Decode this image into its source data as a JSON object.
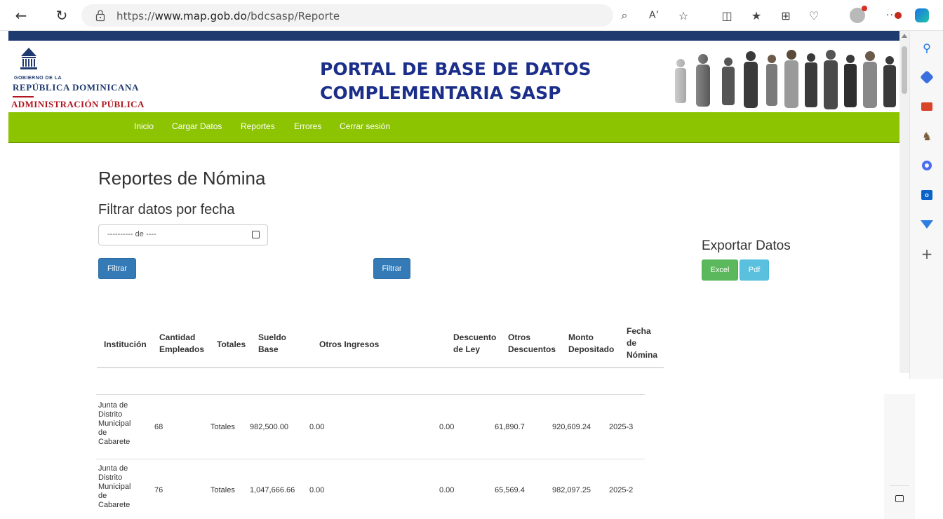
{
  "browser": {
    "url_prefix": "https://",
    "url_domain": "www.map.gob.do",
    "url_path": "/bdcsasp/Reporte"
  },
  "logo": {
    "line1": "GOBIERNO DE LA",
    "line2": "REPÚBLICA DOMINICANA",
    "line3": "ADMINISTRACIÓN PÚBLICA"
  },
  "header": {
    "title_line1": "PORTAL DE BASE DE DATOS",
    "title_line2": "COMPLEMENTARIA SASP"
  },
  "nav": {
    "items": [
      "Inicio",
      "Cargar Datos",
      "Reportes",
      "Errores",
      "Cerrar sesión"
    ]
  },
  "main": {
    "page_title": "Reportes de Nómina",
    "filter_title": "Filtrar datos por fecha",
    "date_placeholder": "---------- de ----",
    "filter_button": "Filtrar",
    "filter_button_2": "Filtrar",
    "export_title": "Exportar Datos",
    "excel_button": "Excel",
    "pdf_button": "Pdf"
  },
  "table": {
    "headers": {
      "institucion": "Institución",
      "cantidad_1": "Cantidad",
      "cantidad_2": "Empleados",
      "totales": "Totales",
      "sueldo_1": "Sueldo",
      "sueldo_2": "Base",
      "otros_ingresos": "Otros Ingresos",
      "descuento_1": "Descuento",
      "descuento_2": "de Ley",
      "otros_desc_1": "Otros",
      "otros_desc_2": "Descuentos",
      "monto_1": "Monto",
      "monto_2": "Depositado",
      "fecha_1": "Fecha",
      "fecha_2": "de",
      "fecha_3": "Nómina"
    },
    "rows": [
      {
        "inst1": "Junta de",
        "inst2": "Distrito",
        "inst3": "Municipal",
        "inst4": "de",
        "inst5": "Cabarete",
        "cantidad": "68",
        "totales": "Totales",
        "sueldo": "982,500.00",
        "otros_ingresos": "0.00",
        "descuento": "0.00",
        "otros_desc": "61,890.7",
        "monto": "920,609.24",
        "fecha": "2025-3"
      },
      {
        "inst1": "Junta de",
        "inst2": "Distrito",
        "inst3": "Municipal",
        "inst4": "de",
        "inst5": "Cabarete",
        "cantidad": "76",
        "totales": "Totales",
        "sueldo": "1,047,666.66",
        "otros_ingresos": "0.00",
        "descuento": "0.00",
        "otros_desc": "65,569.4",
        "monto": "982,097.25",
        "fecha": "2025-2"
      }
    ]
  },
  "colors": {
    "nav_green": "#8cc401",
    "header_blue": "#1b2e8a",
    "btn_blue": "#337ab7",
    "btn_green": "#5cb85c",
    "btn_cyan": "#5bc0de"
  }
}
